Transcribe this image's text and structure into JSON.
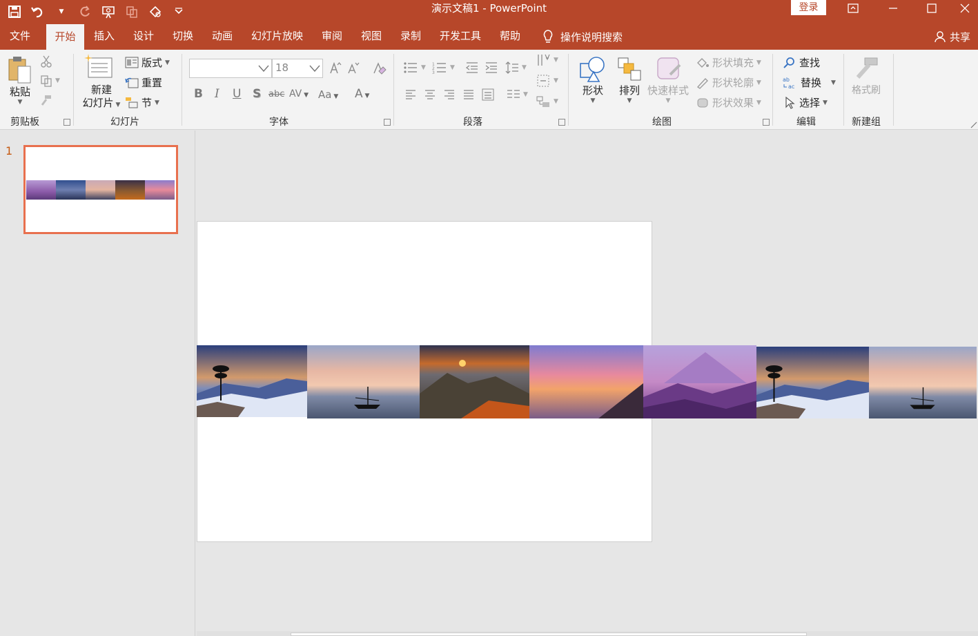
{
  "titlebar": {
    "title": "演示文稿1  -  PowerPoint",
    "login": "登录",
    "bg_color": "#b7472a"
  },
  "tabs": [
    {
      "label": "文件"
    },
    {
      "label": "开始",
      "active": true
    },
    {
      "label": "插入"
    },
    {
      "label": "设计"
    },
    {
      "label": "切换"
    },
    {
      "label": "动画"
    },
    {
      "label": "幻灯片放映"
    },
    {
      "label": "审阅"
    },
    {
      "label": "视图"
    },
    {
      "label": "录制"
    },
    {
      "label": "开发工具"
    },
    {
      "label": "帮助"
    }
  ],
  "tellme": "操作说明搜索",
  "share": "共享",
  "ribbon": {
    "clipboard": {
      "paste": "粘贴",
      "group": "剪贴板"
    },
    "slides": {
      "new_slide_line1": "新建",
      "new_slide_line2": "幻灯片",
      "layout": "版式",
      "reset": "重置",
      "section": "节",
      "group": "幻灯片"
    },
    "font": {
      "font_name": "",
      "font_size": "18",
      "bold": "B",
      "italic": "I",
      "underline": "U",
      "shadow": "S",
      "strike": "abc",
      "spacing": "AV",
      "case": "Aa",
      "color": "A",
      "group": "字体"
    },
    "paragraph": {
      "group": "段落"
    },
    "drawing": {
      "shapes": "形状",
      "arrange": "排列",
      "quick_styles": "快速样式",
      "shape_fill": "形状填充",
      "shape_outline": "形状轮廓",
      "shape_effects": "形状效果",
      "group": "绘图"
    },
    "editing": {
      "find": "查找",
      "replace": "替换",
      "select": "选择",
      "group": "编辑"
    },
    "newgroup": {
      "format_painter": "格式刷",
      "group": "新建组"
    }
  },
  "thumbnails": {
    "slide_number": "1"
  }
}
